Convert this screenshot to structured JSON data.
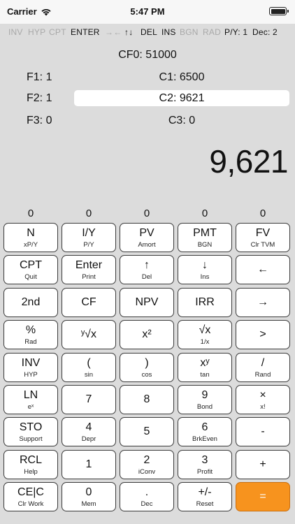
{
  "status_bar": {
    "carrier": "Carrier",
    "time": "5:47 PM"
  },
  "indicators": [
    {
      "label": "INV",
      "active": false
    },
    {
      "label": "HYP",
      "active": false
    },
    {
      "label": "CPT",
      "active": false
    },
    {
      "label": "ENTER",
      "active": true
    },
    {
      "label": "→←",
      "active": false
    },
    {
      "label": "↑↓",
      "active": true
    },
    {
      "label": "DEL",
      "active": true
    },
    {
      "label": "INS",
      "active": true
    },
    {
      "label": "BGN",
      "active": false
    },
    {
      "label": "RAD",
      "active": false
    },
    {
      "label": "P/Y: 1",
      "active": true
    },
    {
      "label": "Dec: 2",
      "active": true
    }
  ],
  "cashflow": {
    "cf0": "CF0: 51000",
    "rows": [
      {
        "f": "F1: 1",
        "c": "C1: 6500",
        "selected": false
      },
      {
        "f": "F2: 1",
        "c": "C2: 9621",
        "selected": true
      },
      {
        "f": "F3: 0",
        "c": "C3: 0",
        "selected": false
      }
    ]
  },
  "display": {
    "value": "9,621"
  },
  "memory": [
    "0",
    "0",
    "0",
    "0",
    "0"
  ],
  "keys": [
    [
      {
        "main": "N",
        "sub": "xP/Y"
      },
      {
        "main": "I/Y",
        "sub": "P/Y"
      },
      {
        "main": "PV",
        "sub": "Amort"
      },
      {
        "main": "PMT",
        "sub": "BGN"
      },
      {
        "main": "FV",
        "sub": "Clr TVM"
      }
    ],
    [
      {
        "main": "CPT",
        "sub": "Quit"
      },
      {
        "main": "Enter",
        "sub": "Print"
      },
      {
        "main": "↑",
        "sub": "Del"
      },
      {
        "main": "↓",
        "sub": "Ins"
      },
      {
        "main": "←",
        "sub": ""
      }
    ],
    [
      {
        "main": "2nd",
        "sub": ""
      },
      {
        "main": "CF",
        "sub": ""
      },
      {
        "main": "NPV",
        "sub": ""
      },
      {
        "main": "IRR",
        "sub": ""
      },
      {
        "main": "→",
        "sub": ""
      }
    ],
    [
      {
        "main": "%",
        "sub": "Rad"
      },
      {
        "main": "ʸ√x",
        "sub": ""
      },
      {
        "main": "x²",
        "sub": ""
      },
      {
        "main": "√x",
        "sub": "1/x"
      },
      {
        "main": ">",
        "sub": ""
      }
    ],
    [
      {
        "main": "INV",
        "sub": "HYP"
      },
      {
        "main": "(",
        "sub": "sin"
      },
      {
        "main": ")",
        "sub": "cos"
      },
      {
        "main": "xʸ",
        "sub": "tan"
      },
      {
        "main": "/",
        "sub": "Rand"
      }
    ],
    [
      {
        "main": "LN",
        "sub": "eˣ"
      },
      {
        "main": "7",
        "sub": ""
      },
      {
        "main": "8",
        "sub": ""
      },
      {
        "main": "9",
        "sub": "Bond"
      },
      {
        "main": "×",
        "sub": "x!"
      }
    ],
    [
      {
        "main": "STO",
        "sub": "Support"
      },
      {
        "main": "4",
        "sub": "Depr"
      },
      {
        "main": "5",
        "sub": ""
      },
      {
        "main": "6",
        "sub": "BrkEven"
      },
      {
        "main": "-",
        "sub": ""
      }
    ],
    [
      {
        "main": "RCL",
        "sub": "Help"
      },
      {
        "main": "1",
        "sub": ""
      },
      {
        "main": "2",
        "sub": "iConv"
      },
      {
        "main": "3",
        "sub": "Profit"
      },
      {
        "main": "+",
        "sub": ""
      }
    ],
    [
      {
        "main": "CE|C",
        "sub": "Clr Work"
      },
      {
        "main": "0",
        "sub": "Mem"
      },
      {
        "main": ".",
        "sub": "Dec"
      },
      {
        "main": "+/-",
        "sub": "Reset"
      },
      {
        "main": "=",
        "sub": ""
      }
    ]
  ],
  "colors": {
    "equals_key": "#f7931e",
    "background": "#dcdcdc"
  }
}
